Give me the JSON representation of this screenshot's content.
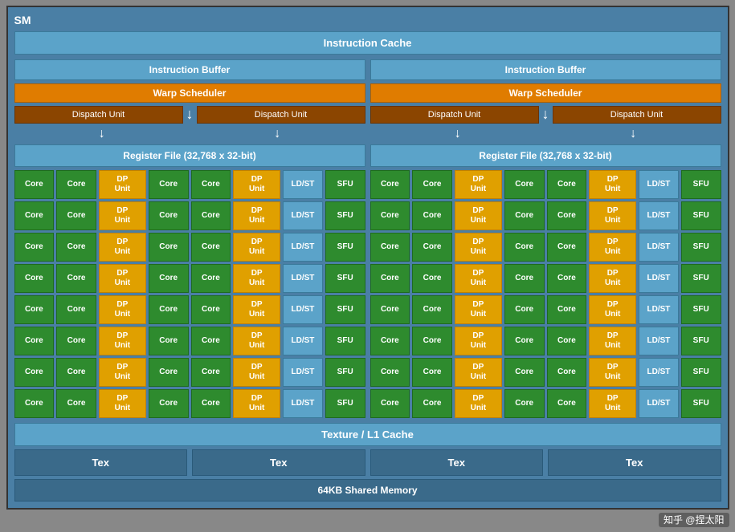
{
  "title": "SM",
  "instructionCache": "Instruction Cache",
  "left": {
    "instructionBuffer": "Instruction Buffer",
    "warpScheduler": "Warp Scheduler",
    "dispatchUnits": [
      "Dispatch Unit",
      "Dispatch Unit"
    ],
    "registerFile": "Register File (32,768 x 32-bit)"
  },
  "right": {
    "instructionBuffer": "Instruction Buffer",
    "warpScheduler": "Warp Scheduler",
    "dispatchUnits": [
      "Dispatch Unit",
      "Dispatch Unit"
    ],
    "registerFile": "Register File (32,768 x 32-bit)"
  },
  "coreRow": [
    "Core",
    "Core",
    "DP\nUnit",
    "Core",
    "Core",
    "DP\nUnit",
    "LD/ST",
    "SFU"
  ],
  "numRows": 8,
  "textureCache": "Texture / L1 Cache",
  "texUnits": [
    "Tex",
    "Tex",
    "Tex",
    "Tex"
  ],
  "sharedMemory": "64KB Shared Memory",
  "watermark": "知乎 @捏太阳"
}
